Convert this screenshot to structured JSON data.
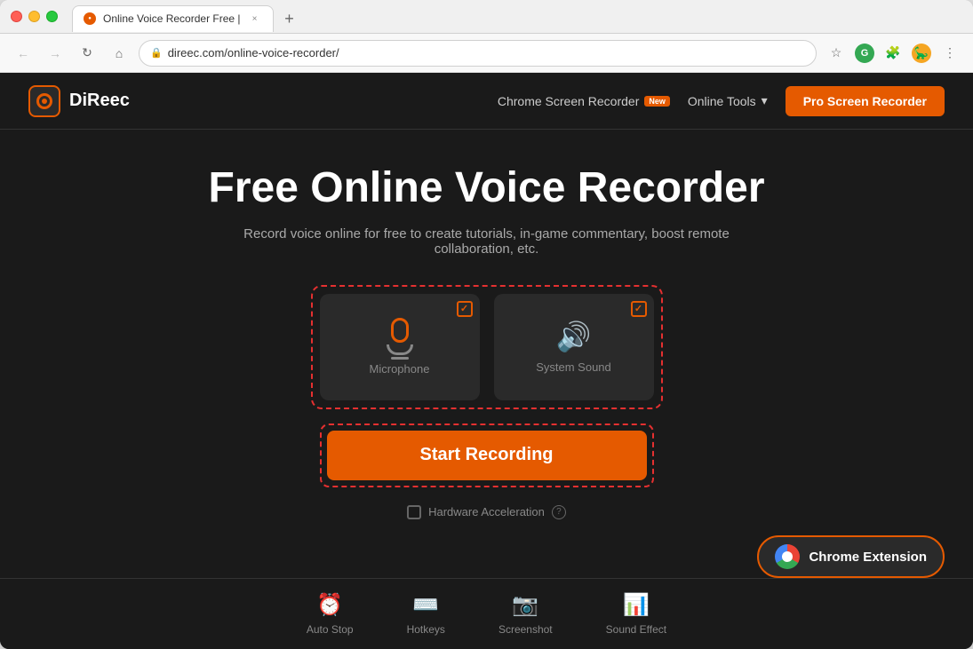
{
  "window": {
    "tab_title": "Online Voice Recorder Free |",
    "tab_close": "×",
    "tab_new": "+",
    "url": "direec.com/online-voice-recorder/"
  },
  "nav": {
    "brand_name": "DiReec",
    "chrome_screen_recorder": "Chrome Screen Recorder",
    "chrome_screen_badge": "New",
    "online_tools": "Online Tools",
    "pro_btn": "Pro Screen Recorder"
  },
  "hero": {
    "title": "Free Online Voice Recorder",
    "subtitle": "Record voice online for free to create tutorials, in-game commentary, boost remote collaboration, etc."
  },
  "controls": {
    "microphone_label": "Microphone",
    "system_sound_label": "System Sound",
    "start_btn": "Start Recording",
    "hw_accel_label": "Hardware Acceleration"
  },
  "chrome_ext": {
    "label": "Chrome Extension"
  },
  "features": [
    {
      "icon": "⏰",
      "label": "Auto Stop"
    },
    {
      "icon": "⌨",
      "label": "Hotkeys"
    },
    {
      "icon": "📷",
      "label": "Screenshot"
    },
    {
      "icon": "📊",
      "label": "Sound Effect"
    }
  ]
}
